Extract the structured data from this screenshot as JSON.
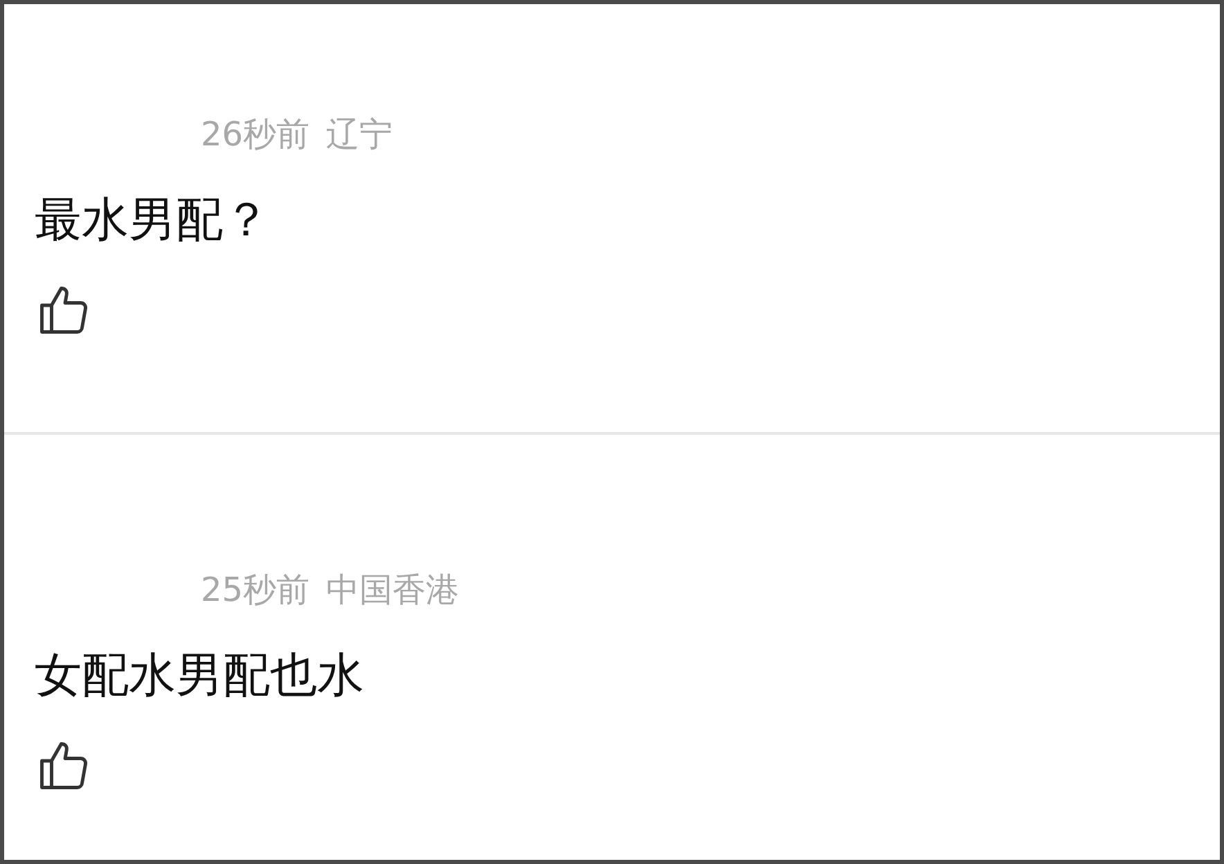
{
  "comments": [
    {
      "time": "26秒前",
      "location": "辽宁",
      "text": "最水男配？"
    },
    {
      "time": "25秒前",
      "location": "中国香港",
      "text": "女配水男配也水"
    }
  ]
}
